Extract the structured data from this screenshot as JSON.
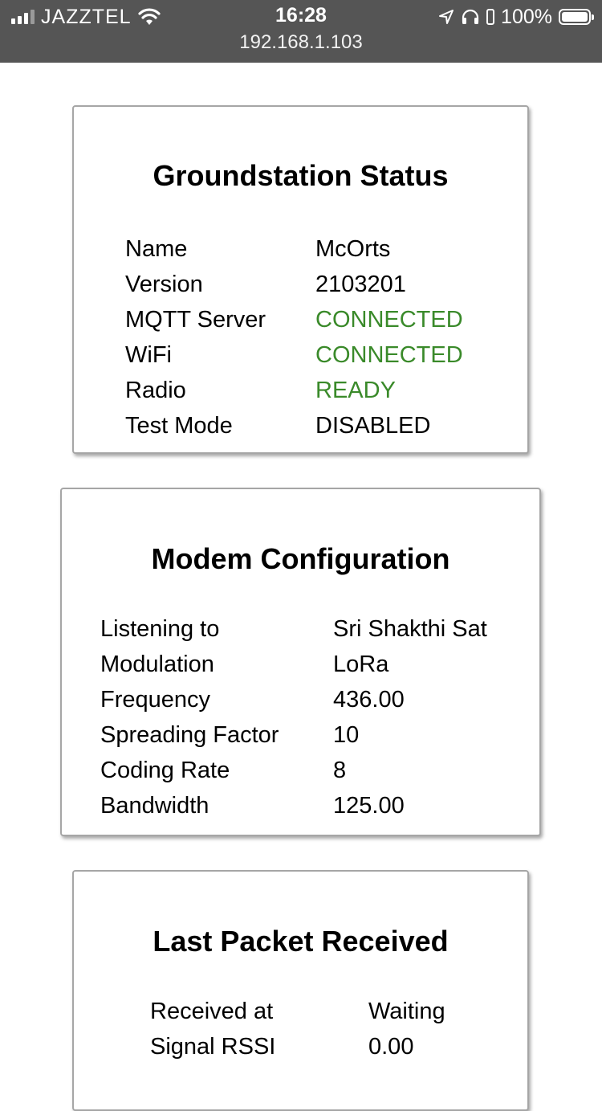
{
  "status_bar": {
    "carrier": "JAZZTEL",
    "time": "16:28",
    "url": "192.168.1.103",
    "battery_percent": "100%",
    "icons": [
      "signal-bars-icon",
      "wifi-icon",
      "location-arrow-icon",
      "headphones-icon",
      "battery-icon"
    ]
  },
  "groundstation": {
    "title": "Groundstation Status",
    "rows": [
      {
        "label": "Name",
        "value": "McOrts"
      },
      {
        "label": "Version",
        "value": "2103201"
      },
      {
        "label": "MQTT Server",
        "value": "CONNECTED"
      },
      {
        "label": "WiFi",
        "value": "CONNECTED"
      },
      {
        "label": "Radio",
        "value": "READY"
      },
      {
        "label": "Test Mode",
        "value": "DISABLED"
      }
    ]
  },
  "modem": {
    "title": "Modem Configuration",
    "rows": [
      {
        "label": "Listening to",
        "value": "Sri Shakthi Sat"
      },
      {
        "label": "Modulation",
        "value": "LoRa"
      },
      {
        "label": "Frequency",
        "value": "436.00"
      },
      {
        "label": "Spreading Factor",
        "value": "10"
      },
      {
        "label": "Coding Rate",
        "value": "8"
      },
      {
        "label": "Bandwidth",
        "value": "125.00"
      }
    ]
  },
  "packet": {
    "title": "Last Packet Received",
    "rows": [
      {
        "label": "Received at",
        "value": "Waiting"
      },
      {
        "label": "Signal RSSI",
        "value": "0.00"
      }
    ]
  },
  "colors": {
    "status_ok": "#3a8a2a",
    "status_bar_bg": "#555555"
  }
}
